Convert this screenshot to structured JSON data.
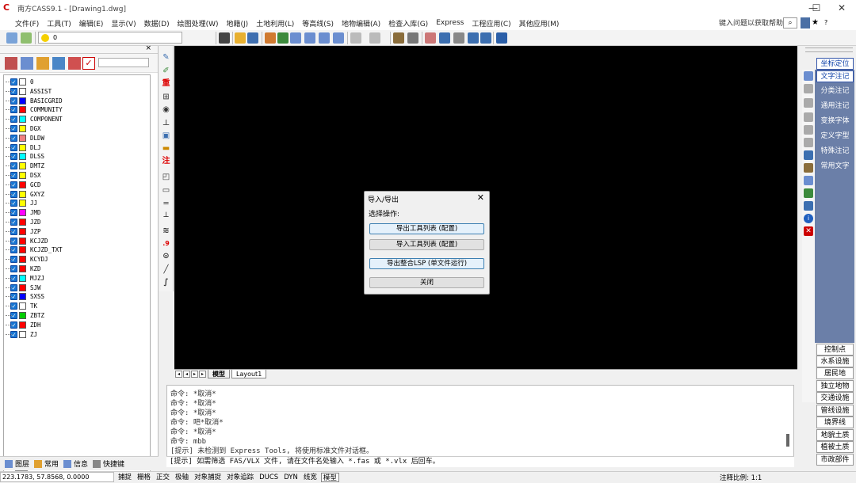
{
  "window": {
    "title": "南方CASS9.1 - [Drawing1.dwg]",
    "logo": "C",
    "minimize": "—",
    "maximize": "☐",
    "close": "✕"
  },
  "menu": [
    "文件(F)",
    "工具(T)",
    "编辑(E)",
    "显示(V)",
    "数据(D)",
    "绘图处理(W)",
    "地籍(J)",
    "土地利用(L)",
    "等高线(S)",
    "地物编辑(A)",
    "检查入库(G)",
    "Express",
    "工程应用(C)",
    "其他应用(M)"
  ],
  "help_prompt": "键入问题以获取帮助",
  "toolbar": {
    "layer_value": "0"
  },
  "layer_panel": {
    "layers": [
      {
        "name": "0",
        "color": "#ffffff"
      },
      {
        "name": "ASSIST",
        "color": "#ffffff"
      },
      {
        "name": "BASICGRID",
        "color": "#0000ff"
      },
      {
        "name": "COMMUNITY",
        "color": "#ff0000"
      },
      {
        "name": "COMPONENT",
        "color": "#00ffff"
      },
      {
        "name": "DGX",
        "color": "#ffff00"
      },
      {
        "name": "DLDW",
        "color": "#f08080"
      },
      {
        "name": "DLJ",
        "color": "#ffff00"
      },
      {
        "name": "DLSS",
        "color": "#00ffff"
      },
      {
        "name": "DMTZ",
        "color": "#ffff00"
      },
      {
        "name": "DSX",
        "color": "#ffff00"
      },
      {
        "name": "GCD",
        "color": "#ff0000"
      },
      {
        "name": "GXYZ",
        "color": "#ffff00"
      },
      {
        "name": "JJ",
        "color": "#ffff00"
      },
      {
        "name": "JMD",
        "color": "#ff00ff"
      },
      {
        "name": "JZD",
        "color": "#ff0000"
      },
      {
        "name": "JZP",
        "color": "#ff0000"
      },
      {
        "name": "KCJZD",
        "color": "#ff0000"
      },
      {
        "name": "KCJZD_TXT",
        "color": "#ff0000"
      },
      {
        "name": "KCYDJ",
        "color": "#ff0000"
      },
      {
        "name": "KZD",
        "color": "#ff0000"
      },
      {
        "name": "MJZJ",
        "color": "#00ffff"
      },
      {
        "name": "SJW",
        "color": "#ff0000"
      },
      {
        "name": "SXSS",
        "color": "#0000ff"
      },
      {
        "name": "TK",
        "color": "#ffffff"
      },
      {
        "name": "ZBTZ",
        "color": "#00cc00"
      },
      {
        "name": "ZDH",
        "color": "#ff0000"
      },
      {
        "name": "ZJ",
        "color": "#ffffff"
      }
    ],
    "tabs": [
      "图层",
      "常用",
      "信息",
      "快捷键"
    ]
  },
  "drawing_tabs": [
    "模型",
    "Layout1"
  ],
  "command_lines": [
    "命令: *取消*",
    "命令: *取消*",
    "命令: *取消*",
    "命令: 吧*取消*",
    "命令: *取消*",
    "命令: mbb",
    "[提示] 未检测到 Express Tools, 将使用标准文件对话框。"
  ],
  "command_input": "[提示] 如需筛选 FAS/VLX 文件, 请在文件名处输入 *.fas 或 *.vlx 后回车。",
  "right_panel": {
    "top_buttons": [
      "坐标定位",
      "文字注记"
    ],
    "blue_items": [
      "分类注记",
      "通用注记",
      "变换字体",
      "定义字型",
      "特殊注记",
      "常用文字"
    ],
    "bottom_buttons": [
      "控制点",
      "水系设施",
      "居民地",
      "独立地物",
      "交通设施",
      "管线设施",
      "境界线",
      "地貌土质",
      "植被土质",
      "市政部件"
    ]
  },
  "dialog": {
    "title": "导入/导出",
    "label": "选择操作:",
    "buttons": [
      "导出工具列表 (配置)",
      "导入工具列表 (配置)",
      "导出整合LSP (单文件运行)",
      "关闭"
    ]
  },
  "status": {
    "coords": "223.1783, 57.8568, 0.0000",
    "toggles": [
      "捕捉",
      "栅格",
      "正交",
      "极轴",
      "对象捕捉",
      "对象追踪",
      "DUCS",
      "DYN",
      "线宽",
      "模型"
    ],
    "scale_label": "注释比例:",
    "scale_value": "1:1"
  }
}
